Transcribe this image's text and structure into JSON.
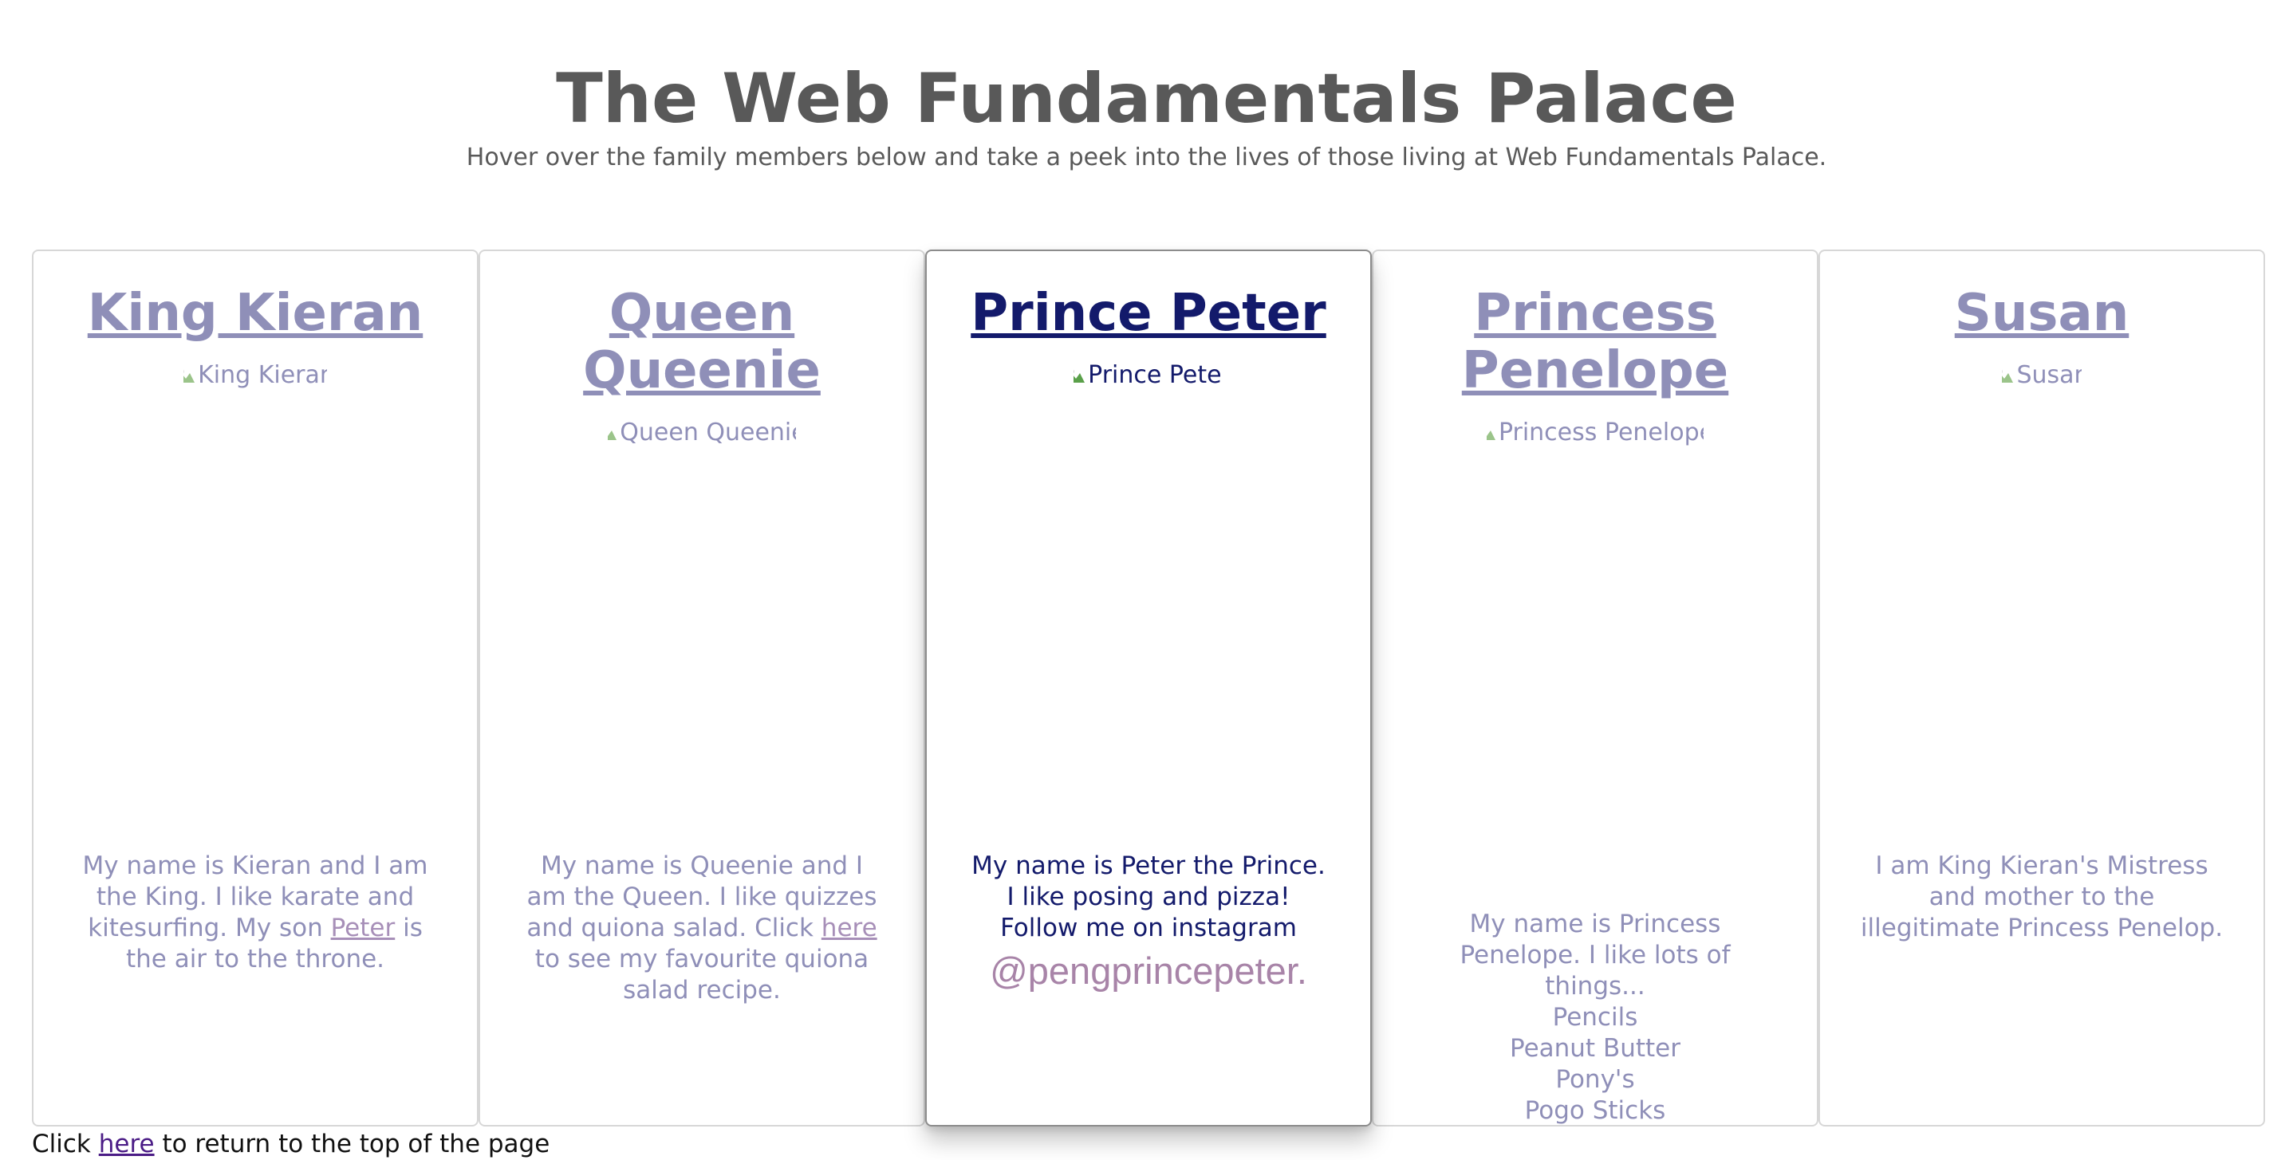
{
  "header": {
    "title": "The Web Fundamentals Palace",
    "subtitle": "Hover over the family members below and take a peek into the lives of those living at Web Fundamentals Palace."
  },
  "cards": [
    {
      "name": "King Kieran",
      "image_alt": "King Kieran",
      "desc_before": "My name is Kieran and I am the King. I like karate and kitesurfing. My son ",
      "desc_link": "Peter",
      "desc_after": " is the air to the throne."
    },
    {
      "name": "Queen Queenie",
      "image_alt": "Queen Queenie",
      "desc_before": "My name is Queenie and I am the Queen. I like quizzes and quiona salad. Click ",
      "desc_link": "here",
      "desc_after": " to see my favourite quiona salad recipe."
    },
    {
      "name": "Prince Peter",
      "image_alt": "Prince Peter",
      "desc": "My name is Peter the Prince. I like posing and pizza! Follow me on instagram",
      "handle": "@pengprincepeter."
    },
    {
      "name_line1": "Princess",
      "name_line2": "Penelope",
      "image_alt": "Princess Penelope",
      "desc": "My name is Princess Penelope. I like lots of things...",
      "likes": [
        "Pencils",
        "Peanut Butter",
        "Pony's",
        "Pogo Sticks"
      ]
    },
    {
      "name": "Susan",
      "image_alt": "Susan",
      "desc": "I am King Kieran's Mistress and mother to the illegitimate Princess Penelop."
    }
  ],
  "footer": {
    "before": "Click ",
    "link": "here",
    "after": " to return to the top of the page"
  },
  "colors": {
    "title": "#595959",
    "card_text": "#8f8fb8",
    "active_card_text": "#131a6b",
    "handle": "#a884a8",
    "visited_link": "#4b1c86"
  },
  "active_card": "Prince Peter"
}
